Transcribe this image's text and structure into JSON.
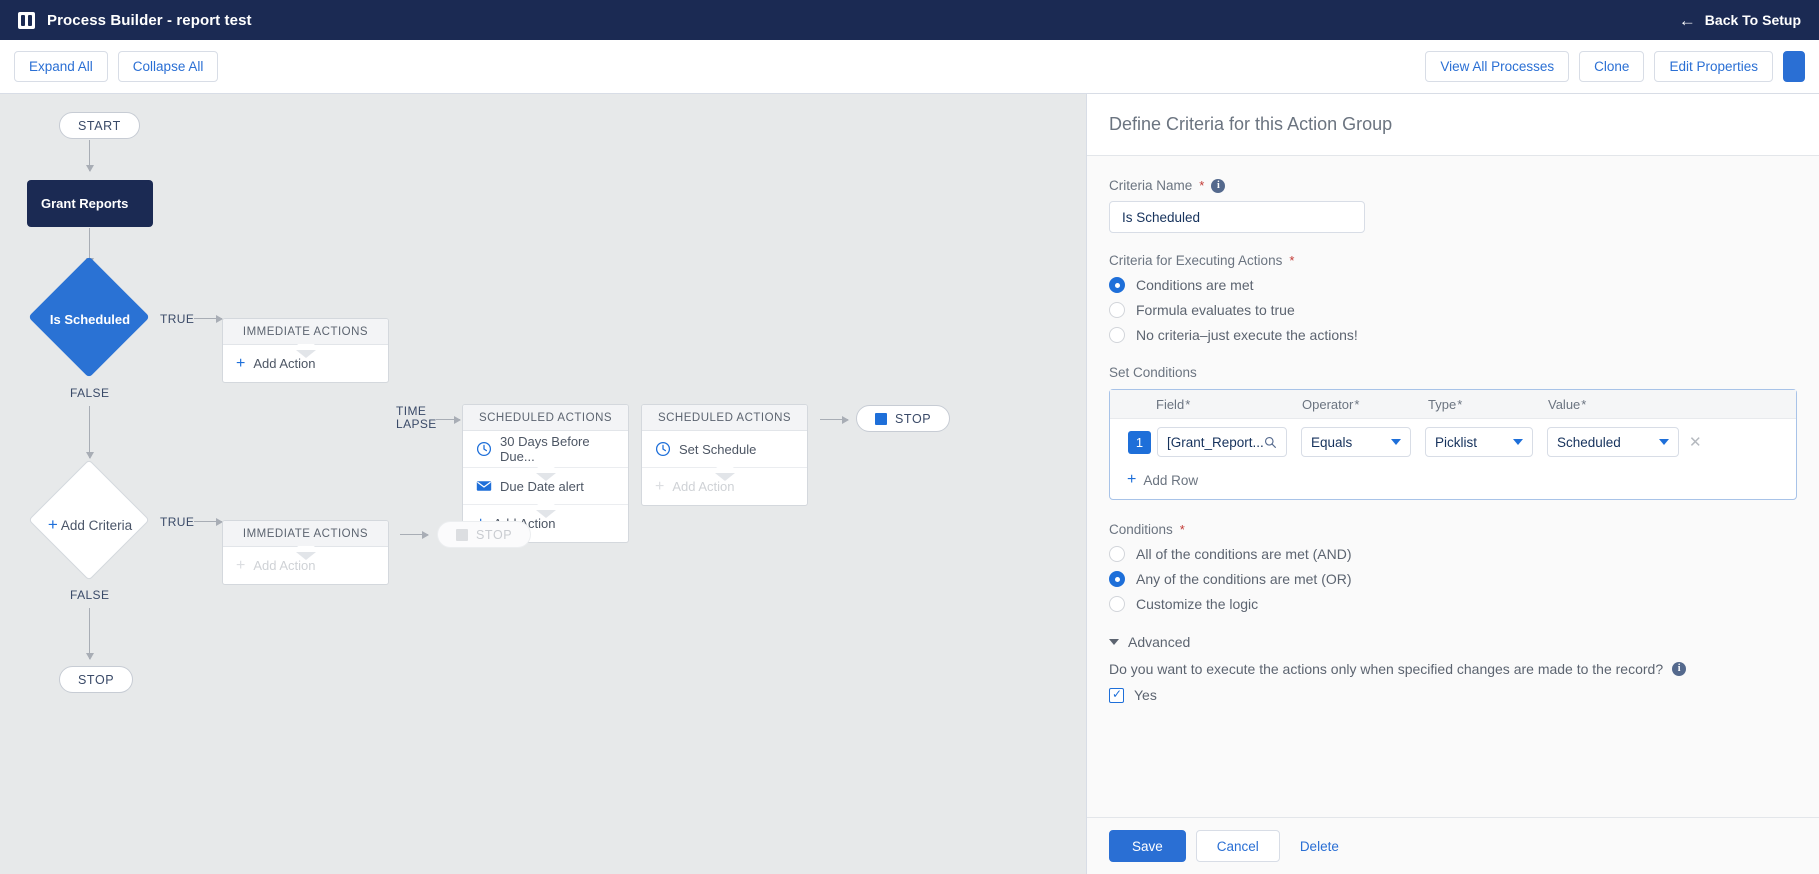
{
  "header": {
    "app_icon": "process-builder-icon",
    "title": "Process Builder - report test",
    "back_label": "Back To Setup",
    "back_icon": "arrow-left-icon"
  },
  "toolbar": {
    "expand_all": "Expand All",
    "collapse_all": "Collapse All",
    "view_all_processes": "View All Processes",
    "clone": "Clone",
    "edit_properties": "Edit Properties"
  },
  "canvas": {
    "start_label": "START",
    "object_node": "Grant Reports",
    "criteria_1": {
      "label": "Is Scheduled",
      "true_label": "TRUE",
      "false_label": "FALSE"
    },
    "criteria_2": {
      "label": "Add Criteria",
      "true_label": "TRUE",
      "false_label": "FALSE"
    },
    "time_lapse_line1": "TIME",
    "time_lapse_line2": "LAPSE",
    "immediate_actions_1": {
      "header": "IMMEDIATE ACTIONS",
      "add_action": "Add Action"
    },
    "immediate_actions_2": {
      "header": "IMMEDIATE ACTIONS",
      "add_action": "Add Action"
    },
    "scheduled_actions_1": {
      "header": "SCHEDULED ACTIONS",
      "schedule_label": "30 Days Before Due...",
      "action_label": "Due Date alert",
      "add_action": "Add Action",
      "schedule_icon": "clock-icon",
      "action_icon": "email-icon"
    },
    "scheduled_actions_2": {
      "header": "SCHEDULED ACTIONS",
      "schedule_label": "Set Schedule",
      "add_action": "Add Action",
      "schedule_icon": "clock-icon"
    },
    "stop_top": "STOP",
    "stop_mid": "STOP",
    "stop_bottom": "STOP"
  },
  "panel": {
    "title": "Define Criteria for this Action Group",
    "criteria_name_label": "Criteria Name",
    "criteria_name_value": "Is Scheduled",
    "criteria_exec_label": "Criteria for Executing Actions",
    "criteria_exec_options": [
      {
        "label": "Conditions are met",
        "selected": true
      },
      {
        "label": "Formula evaluates to true",
        "selected": false
      },
      {
        "label": "No criteria–just execute the actions!",
        "selected": false
      }
    ],
    "set_conditions_label": "Set Conditions",
    "condition_columns": [
      "Field",
      "Operator",
      "Type",
      "Value"
    ],
    "condition_rows": [
      {
        "index": "1",
        "field": "[Grant_Report...",
        "field_icon": "search-icon",
        "operator": "Equals",
        "type": "Picklist",
        "value": "Scheduled",
        "remove_icon": "close-icon"
      }
    ],
    "add_row_label": "Add Row",
    "conditions_label": "Conditions",
    "conditions_options": [
      {
        "label": "All of the conditions are met (AND)",
        "selected": false
      },
      {
        "label": "Any of the conditions are met (OR)",
        "selected": true
      },
      {
        "label": "Customize the logic",
        "selected": false
      }
    ],
    "advanced_label": "Advanced",
    "advanced_question": "Do you want to execute the actions only when specified changes are made to the record?",
    "advanced_checkbox_label": "Yes",
    "advanced_checkbox_checked": true,
    "save_label": "Save",
    "cancel_label": "Cancel",
    "delete_label": "Delete"
  },
  "colors": {
    "header_navy": "#1b2a53",
    "accent_blue": "#1e6fd9",
    "link_blue": "#2a6fd4",
    "required_red": "#c23934",
    "canvas_bg": "#e7e9ea"
  }
}
